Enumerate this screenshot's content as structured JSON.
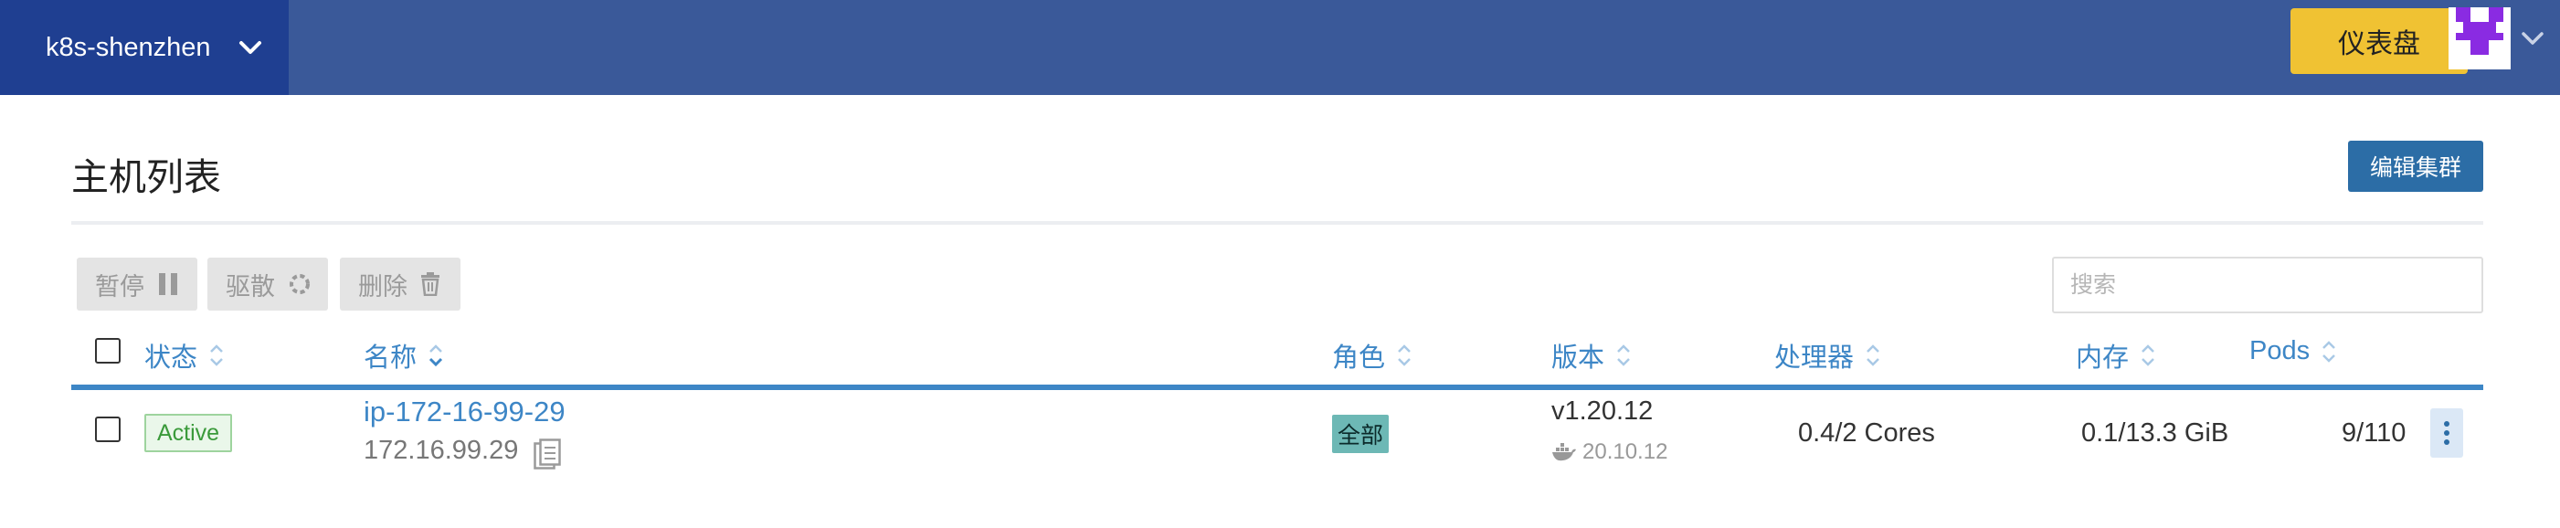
{
  "header": {
    "cluster_name": "k8s-shenzhen",
    "dashboard_label": "仪表盘",
    "colors": {
      "bar": "#3a5999",
      "cluster_bg": "#1f3f91",
      "dashboard_bg": "#f0c233"
    }
  },
  "page": {
    "title": "主机列表",
    "edit_cluster_label": "编辑集群"
  },
  "toolbar": {
    "pause_label": "暂停",
    "drain_label": "驱散",
    "delete_label": "删除",
    "search_placeholder": "搜索"
  },
  "table": {
    "columns": [
      "状态",
      "名称",
      "角色",
      "版本",
      "处理器",
      "内存",
      "Pods"
    ],
    "rows": [
      {
        "status": "Active",
        "name": "ip-172-16-99-29",
        "ip": "172.16.99.29",
        "role": "全部",
        "k8s_version": "v1.20.12",
        "docker_version": "20.10.12",
        "cpu": "0.4/2 Cores",
        "memory": "0.1/13.3 GiB",
        "pods": "9/110"
      }
    ]
  },
  "icons": [
    "chevron-down-icon",
    "avatar-icon",
    "pause-icon",
    "drain-icon",
    "trash-icon",
    "sort-icon",
    "copy-icon",
    "docker-icon",
    "kebab-icon"
  ],
  "accent_color": "#3d86c6"
}
